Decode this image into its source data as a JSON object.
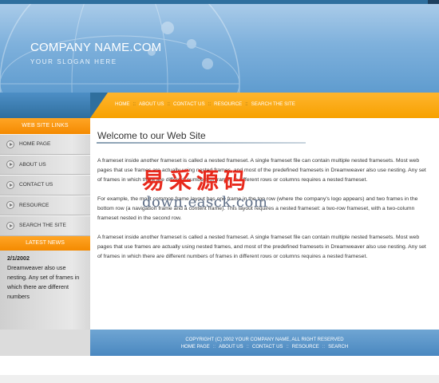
{
  "header": {
    "company_name": "COMPANY NAME.COM",
    "slogan": "YOUR SLOGAN HERE"
  },
  "top_nav": {
    "items": [
      "HOME",
      "ABOUT US",
      "CONTACT US",
      "RESOURCE",
      "SEARCH THE SITE"
    ],
    "separator": "::"
  },
  "sidebar": {
    "links_heading": "WEB SITE LINKS",
    "items": [
      "HOME PAGE",
      "ABOUT US",
      "CONTACT US",
      "RESOURCE",
      "SEARCH THE SITE"
    ],
    "news_heading": "LATEST NEWS",
    "news": {
      "date": "2/1/2002",
      "text": "Dreamweaver also use nesting. Any set of frames in which there are different numbers"
    }
  },
  "main": {
    "title": "Welcome to our Web Site",
    "paragraphs": [
      "A frameset inside another frameset is called a nested frameset. A single frameset file can contain multiple nested framesets. Most web pages that use frames are actually using nested frames, and most of the predefined framesets in Dreamweaver also use nesting. Any set of frames in which there are different numbers of frames in different rows or columns requires a nested frameset.",
      "For example, the most common frame layout has one frame in the top row (where the company's logo appears) and two frames in the bottom row (a navigation frame and a content frame). This layout requires a nested frameset: a two-row frameset, with a two-column frameset nested in the second row.",
      "A frameset inside another frameset is called a nested frameset. A single frameset file can contain multiple nested framesets. Most web pages that use frames are actually using nested frames, and most of the predefined framesets in Dreamweaver also use nesting. Any set of frames in which there are different numbers of frames in different rows or columns requires a nested frameset."
    ]
  },
  "watermark": {
    "chinese": "易采源码",
    "url": "down.easck.com"
  },
  "footer": {
    "copyright": "COPYRIGHT (C) 2002 YOUR COMPANY NAME, ALL RIGHT RESERVED",
    "links": [
      "HOME PAGE",
      "ABOUT US",
      "CONTACT US",
      "RESOURCE",
      "SEARCH"
    ],
    "separator": "::"
  },
  "colors": {
    "accent_orange": "#f7a100",
    "header_blue": "#5f9ccf",
    "dark_blue": "#2f6f9e"
  }
}
